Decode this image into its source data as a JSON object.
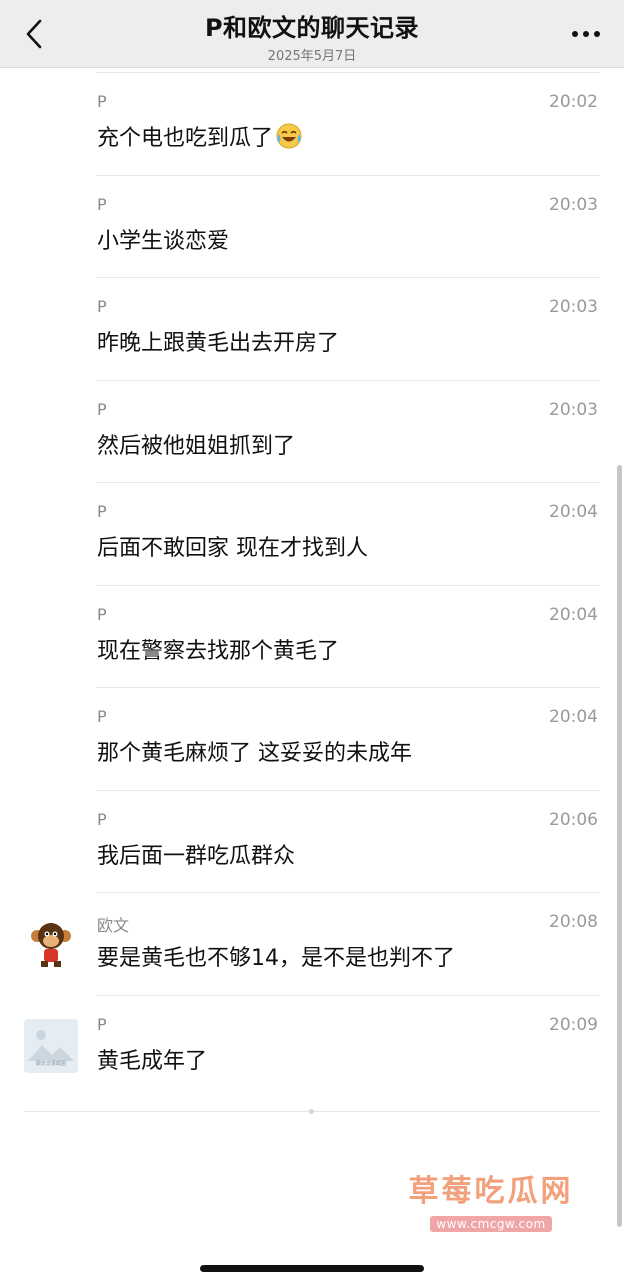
{
  "header": {
    "title": "P和欧文的聊天记录",
    "subtitle": "2025年5月7日",
    "back_icon": "chevron-left-icon",
    "more_icon": "more-dots-icon",
    "background": "#ededed"
  },
  "messages": [
    {
      "sender": "P",
      "time": "20:02",
      "text": "充个电也吃到瓜了"
    },
    {
      "sender": "P",
      "time": "20:03",
      "text": "小学生谈恋爱"
    },
    {
      "sender": "P",
      "time": "20:03",
      "text": "昨晚上跟黄毛出去开房了"
    },
    {
      "sender": "P",
      "time": "20:03",
      "text": "然后被他姐姐抓到了"
    },
    {
      "sender": "P",
      "time": "20:04",
      "text": "后面不敢回家 现在才找到人"
    },
    {
      "sender": "P",
      "time": "20:04",
      "text": "现在警察去找那个黄毛了"
    },
    {
      "sender": "P",
      "time": "20:04",
      "text": "那个黄毛麻烦了 这妥妥的未成年"
    },
    {
      "sender": "P",
      "time": "20:06",
      "text": "我后面一群吃瓜群众"
    },
    {
      "sender": "欧文",
      "time": "20:08",
      "text": "要是黄毛也不够14，是不是也判不了"
    },
    {
      "sender": "P",
      "time": "20:09",
      "text": "黄毛成年了"
    }
  ],
  "avatar_texts": {
    "p_avatar_caption": "聊天记录截图"
  },
  "watermark": {
    "title": "草莓吃瓜网",
    "url": "www.cmcgw.com"
  }
}
